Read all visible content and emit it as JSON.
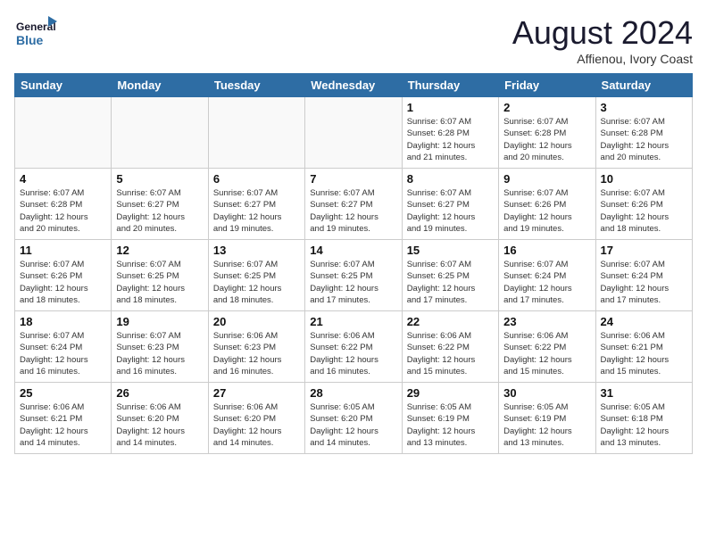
{
  "header": {
    "logo_general": "General",
    "logo_blue": "Blue",
    "month_title": "August 2024",
    "subtitle": "Affienou, Ivory Coast"
  },
  "weekdays": [
    "Sunday",
    "Monday",
    "Tuesday",
    "Wednesday",
    "Thursday",
    "Friday",
    "Saturday"
  ],
  "weeks": [
    [
      {
        "day": "",
        "info": ""
      },
      {
        "day": "",
        "info": ""
      },
      {
        "day": "",
        "info": ""
      },
      {
        "day": "",
        "info": ""
      },
      {
        "day": "1",
        "info": "Sunrise: 6:07 AM\nSunset: 6:28 PM\nDaylight: 12 hours\nand 21 minutes."
      },
      {
        "day": "2",
        "info": "Sunrise: 6:07 AM\nSunset: 6:28 PM\nDaylight: 12 hours\nand 20 minutes."
      },
      {
        "day": "3",
        "info": "Sunrise: 6:07 AM\nSunset: 6:28 PM\nDaylight: 12 hours\nand 20 minutes."
      }
    ],
    [
      {
        "day": "4",
        "info": "Sunrise: 6:07 AM\nSunset: 6:28 PM\nDaylight: 12 hours\nand 20 minutes."
      },
      {
        "day": "5",
        "info": "Sunrise: 6:07 AM\nSunset: 6:27 PM\nDaylight: 12 hours\nand 20 minutes."
      },
      {
        "day": "6",
        "info": "Sunrise: 6:07 AM\nSunset: 6:27 PM\nDaylight: 12 hours\nand 19 minutes."
      },
      {
        "day": "7",
        "info": "Sunrise: 6:07 AM\nSunset: 6:27 PM\nDaylight: 12 hours\nand 19 minutes."
      },
      {
        "day": "8",
        "info": "Sunrise: 6:07 AM\nSunset: 6:27 PM\nDaylight: 12 hours\nand 19 minutes."
      },
      {
        "day": "9",
        "info": "Sunrise: 6:07 AM\nSunset: 6:26 PM\nDaylight: 12 hours\nand 19 minutes."
      },
      {
        "day": "10",
        "info": "Sunrise: 6:07 AM\nSunset: 6:26 PM\nDaylight: 12 hours\nand 18 minutes."
      }
    ],
    [
      {
        "day": "11",
        "info": "Sunrise: 6:07 AM\nSunset: 6:26 PM\nDaylight: 12 hours\nand 18 minutes."
      },
      {
        "day": "12",
        "info": "Sunrise: 6:07 AM\nSunset: 6:25 PM\nDaylight: 12 hours\nand 18 minutes."
      },
      {
        "day": "13",
        "info": "Sunrise: 6:07 AM\nSunset: 6:25 PM\nDaylight: 12 hours\nand 18 minutes."
      },
      {
        "day": "14",
        "info": "Sunrise: 6:07 AM\nSunset: 6:25 PM\nDaylight: 12 hours\nand 17 minutes."
      },
      {
        "day": "15",
        "info": "Sunrise: 6:07 AM\nSunset: 6:25 PM\nDaylight: 12 hours\nand 17 minutes."
      },
      {
        "day": "16",
        "info": "Sunrise: 6:07 AM\nSunset: 6:24 PM\nDaylight: 12 hours\nand 17 minutes."
      },
      {
        "day": "17",
        "info": "Sunrise: 6:07 AM\nSunset: 6:24 PM\nDaylight: 12 hours\nand 17 minutes."
      }
    ],
    [
      {
        "day": "18",
        "info": "Sunrise: 6:07 AM\nSunset: 6:24 PM\nDaylight: 12 hours\nand 16 minutes."
      },
      {
        "day": "19",
        "info": "Sunrise: 6:07 AM\nSunset: 6:23 PM\nDaylight: 12 hours\nand 16 minutes."
      },
      {
        "day": "20",
        "info": "Sunrise: 6:06 AM\nSunset: 6:23 PM\nDaylight: 12 hours\nand 16 minutes."
      },
      {
        "day": "21",
        "info": "Sunrise: 6:06 AM\nSunset: 6:22 PM\nDaylight: 12 hours\nand 16 minutes."
      },
      {
        "day": "22",
        "info": "Sunrise: 6:06 AM\nSunset: 6:22 PM\nDaylight: 12 hours\nand 15 minutes."
      },
      {
        "day": "23",
        "info": "Sunrise: 6:06 AM\nSunset: 6:22 PM\nDaylight: 12 hours\nand 15 minutes."
      },
      {
        "day": "24",
        "info": "Sunrise: 6:06 AM\nSunset: 6:21 PM\nDaylight: 12 hours\nand 15 minutes."
      }
    ],
    [
      {
        "day": "25",
        "info": "Sunrise: 6:06 AM\nSunset: 6:21 PM\nDaylight: 12 hours\nand 14 minutes."
      },
      {
        "day": "26",
        "info": "Sunrise: 6:06 AM\nSunset: 6:20 PM\nDaylight: 12 hours\nand 14 minutes."
      },
      {
        "day": "27",
        "info": "Sunrise: 6:06 AM\nSunset: 6:20 PM\nDaylight: 12 hours\nand 14 minutes."
      },
      {
        "day": "28",
        "info": "Sunrise: 6:05 AM\nSunset: 6:20 PM\nDaylight: 12 hours\nand 14 minutes."
      },
      {
        "day": "29",
        "info": "Sunrise: 6:05 AM\nSunset: 6:19 PM\nDaylight: 12 hours\nand 13 minutes."
      },
      {
        "day": "30",
        "info": "Sunrise: 6:05 AM\nSunset: 6:19 PM\nDaylight: 12 hours\nand 13 minutes."
      },
      {
        "day": "31",
        "info": "Sunrise: 6:05 AM\nSunset: 6:18 PM\nDaylight: 12 hours\nand 13 minutes."
      }
    ]
  ]
}
